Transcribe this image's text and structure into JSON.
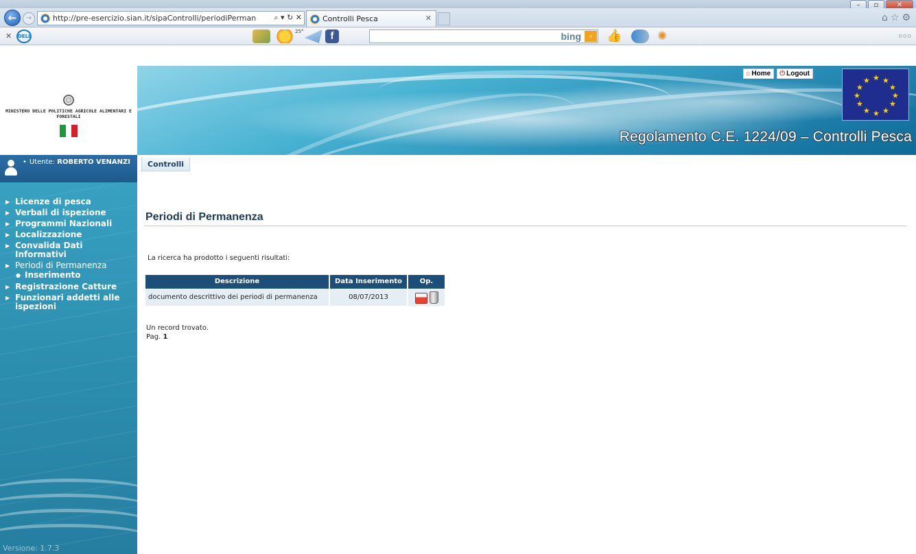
{
  "browser": {
    "address": "http://pre-esercizio.sian.it/sipaControlli/periodiPerman",
    "address_host": "pre-esercizio.sian.it",
    "tab_title": "Controlli Pesca",
    "toolbar_search_brand": "bing"
  },
  "header": {
    "ministry_name": "MINISTERO DELLE POLITICHE AGRICOLE ALIMENTARI E FORESTALI",
    "home_link": "Home",
    "logout_link": "Logout",
    "title": "Regolamento C.E. 1224/09 – Controlli Pesca"
  },
  "sidebar": {
    "user_label": "Utente:",
    "user_name": "ROBERTO VENANZI",
    "menu": [
      {
        "label": "Licenze di pesca"
      },
      {
        "label": "Verbali di ispezione"
      },
      {
        "label": "Programmi Nazionali"
      },
      {
        "label": "Localizzazione"
      },
      {
        "label": "Convalida Dati Informativi"
      },
      {
        "label": "Periodi di Permanenza",
        "current": true
      },
      {
        "label": "Inserimento",
        "sub": true
      },
      {
        "label": "Registrazione Catture"
      },
      {
        "label": "Funzionari addetti alle ispezioni"
      }
    ],
    "version": "Versione: 1.7.3"
  },
  "main": {
    "tab_label": "Controlli",
    "page_title": "Periodi di Permanenza",
    "result_message": "La ricerca ha prodotto i seguenti risultati:",
    "table": {
      "headers": [
        "Descrizione",
        "Data Inserimento",
        "Op."
      ],
      "rows": [
        {
          "descrizione": "documento descrittivo dei periodi di permanenza",
          "data": "08/07/2013"
        }
      ]
    },
    "record_count": "Un record trovato.",
    "pager_label": "Pag.",
    "pager_current": "1"
  },
  "colors": {
    "table_header": "#1d4e7a",
    "table_row": "#e6eef5",
    "sidebar": "#2d8fb0",
    "title": "#1e3a56"
  },
  "icons": [
    "back-arrow-icon",
    "forward-arrow-icon",
    "ie-icon",
    "dell-icon",
    "facebook-icon",
    "bing-search-icon",
    "like-icon",
    "user-icon",
    "home-icon",
    "logout-icon",
    "pdf-icon",
    "trash-icon",
    "emblem-icon",
    "italian-flag",
    "eu-flag"
  ]
}
